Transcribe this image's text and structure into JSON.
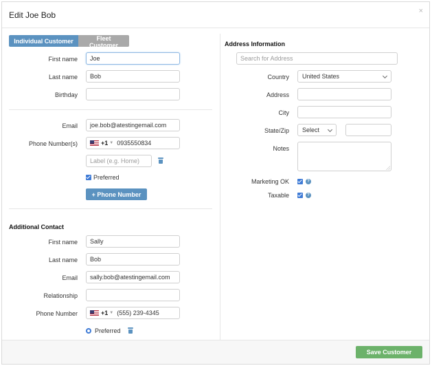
{
  "modal": {
    "title": "Edit Joe Bob",
    "close_glyph": "×"
  },
  "customer_type": {
    "individual": "Individual Customer",
    "fleet": "Fleet Customer",
    "selected": "Individual Customer"
  },
  "customer": {
    "first_name_label": "First name",
    "first_name": "Joe",
    "last_name_label": "Last name",
    "last_name": "Bob",
    "birthday_label": "Birthday",
    "birthday": "",
    "email_label": "Email",
    "email": "joe.bob@atestingemail.com",
    "phone_label": "Phone Number(s)",
    "phone_country_code": "+1",
    "phone_number": "0935550834",
    "phone_label_placeholder": "Label (e.g. Home)",
    "preferred_label": "Preferred",
    "add_phone_label": "+  Phone Number"
  },
  "additional_contact": {
    "title": "Additional Contact",
    "first_name_label": "First name",
    "first_name": "Sally",
    "last_name_label": "Last name",
    "last_name": "Bob",
    "email_label": "Email",
    "email": "sally.bob@atestingemail.com",
    "relationship_label": "Relationship",
    "relationship": "",
    "phone_label": "Phone Number",
    "phone_country_code": "+1",
    "phone_number": "(555) 239-4345",
    "preferred_label": "Preferred"
  },
  "address": {
    "title": "Address Information",
    "search_placeholder": "Search for Address",
    "country_label": "Country",
    "country": "United States",
    "address_label": "Address",
    "address": "",
    "city_label": "City",
    "city": "",
    "state_zip_label": "State/Zip",
    "state": "Select",
    "zip": "",
    "notes_label": "Notes",
    "notes": "",
    "marketing_label": "Marketing OK",
    "taxable_label": "Taxable",
    "help_glyph": "?"
  },
  "footer": {
    "save_label": "Save Customer"
  },
  "icons": {
    "flag": "us-flag-icon",
    "trash": "trash-icon",
    "help": "help-icon",
    "close": "close-icon"
  },
  "colors": {
    "primary": "#5b92c0",
    "save": "#6cb26a",
    "inactive": "#a9a9a9",
    "checkbox": "#3f7bd6"
  }
}
